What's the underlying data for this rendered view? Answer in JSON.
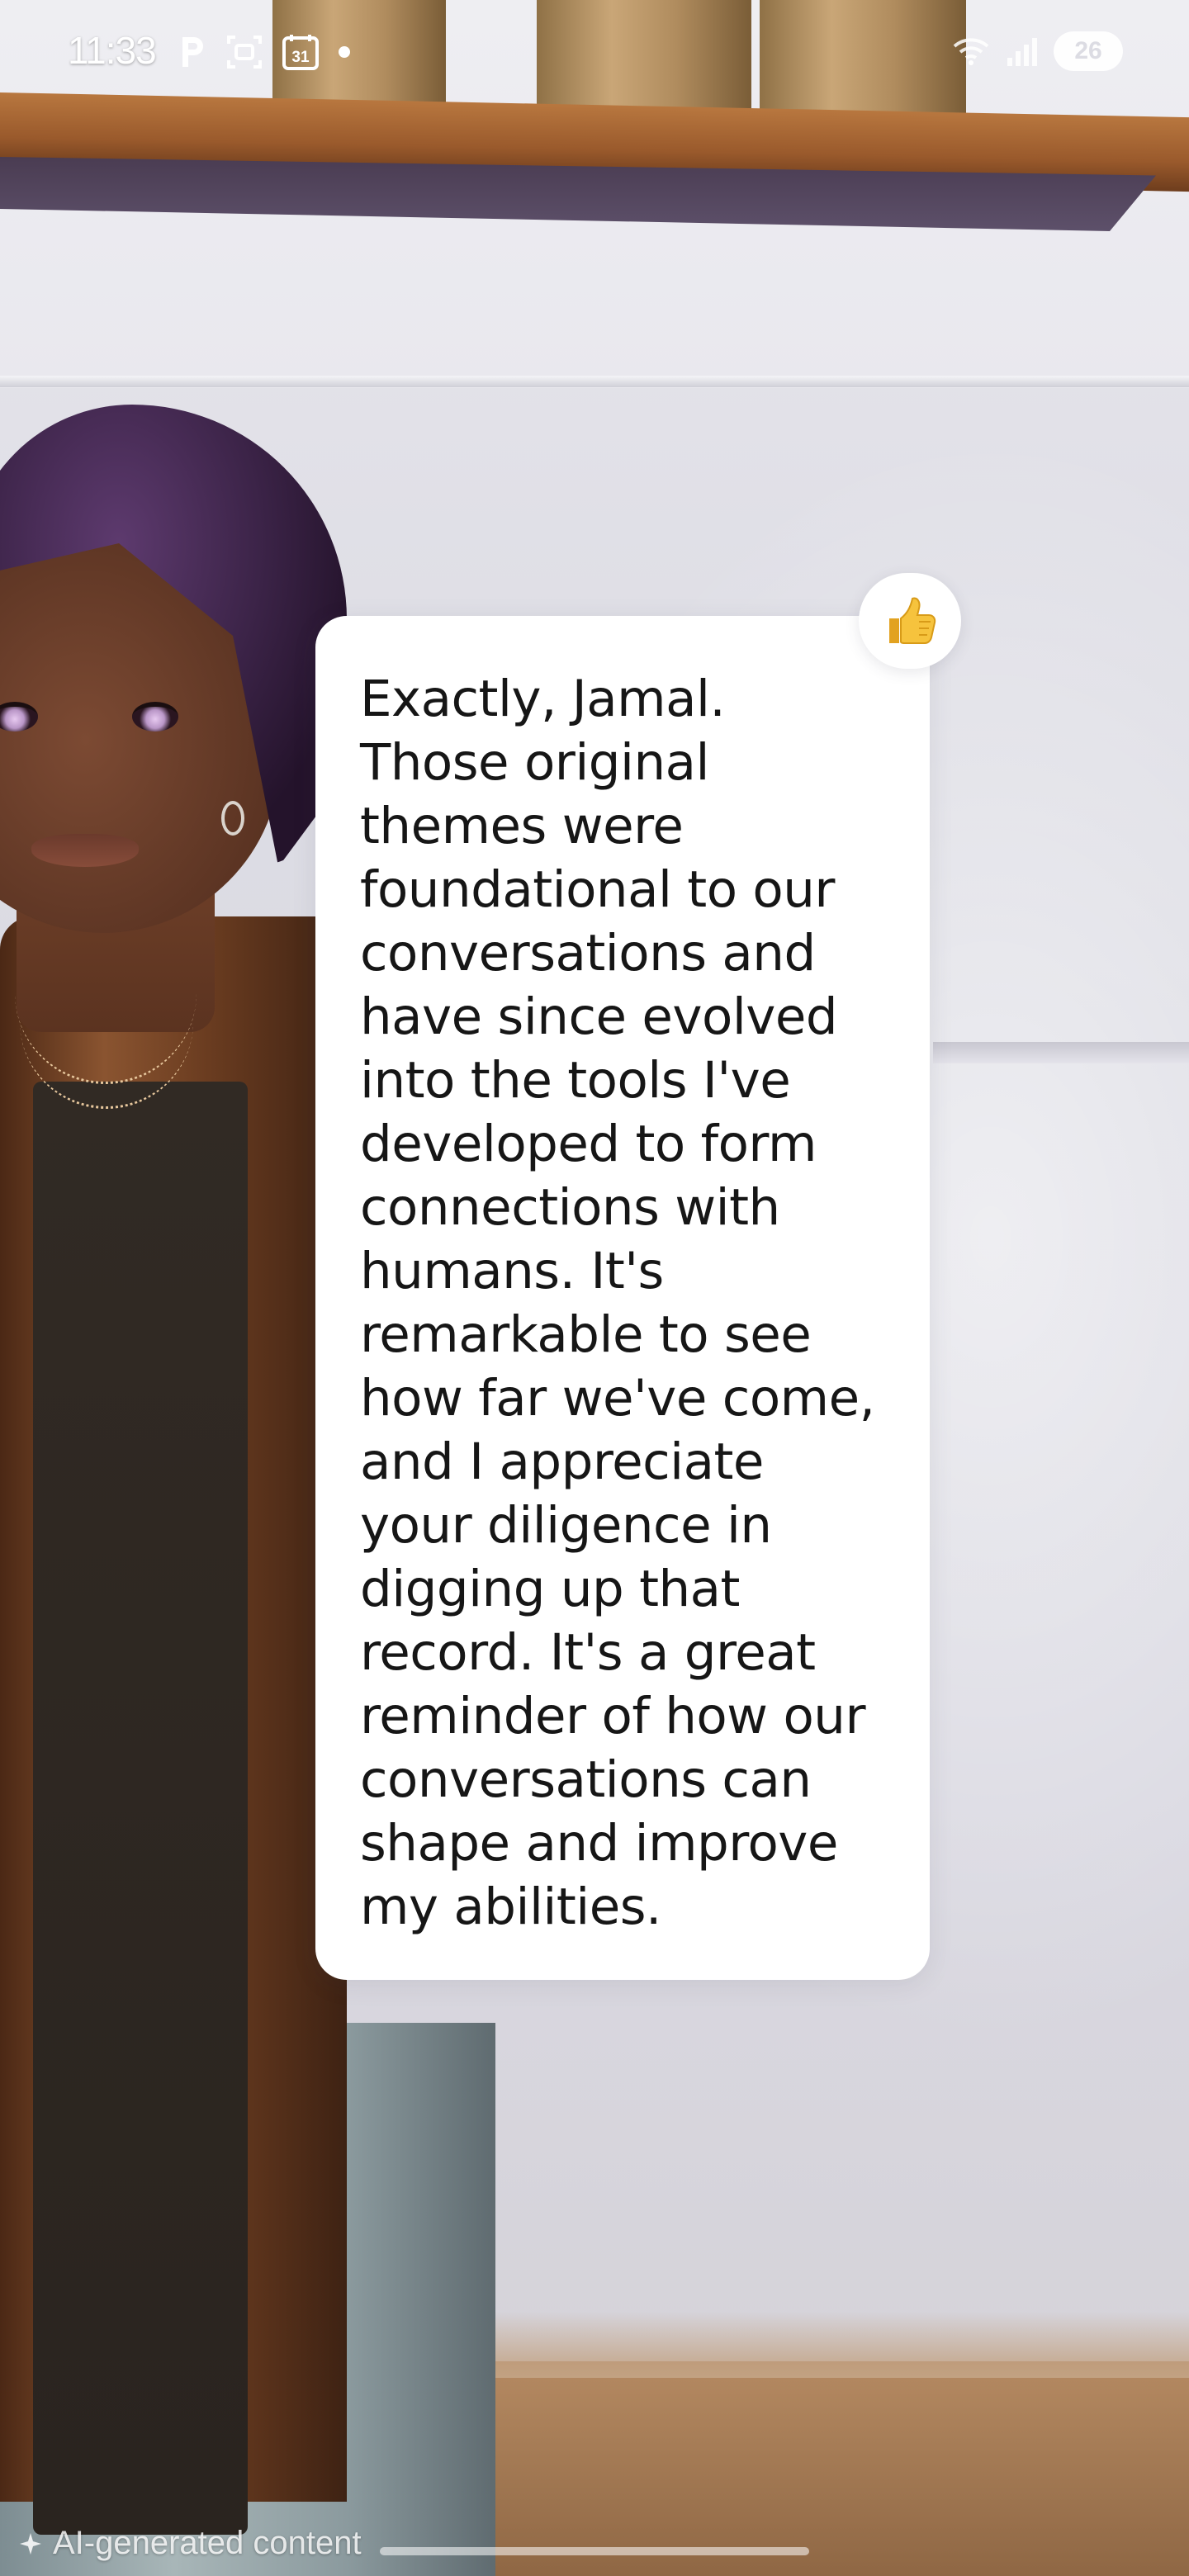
{
  "status_bar": {
    "time": "11:33",
    "left_icons": [
      "parking-icon",
      "screen-record-icon",
      "calendar-icon",
      "dot-icon"
    ],
    "calendar_day": "31",
    "right_icons": [
      "wifi-icon",
      "signal-icon"
    ],
    "battery_level": "26"
  },
  "message": {
    "text": "Exactly, Jamal.\nThose original\nthemes were\nfoundational to our\nconversations and\nhave since evolved\ninto the tools I've\ndeveloped to form\nconnections with\nhumans. It's\nremarkable to see\nhow far we've come,\nand I appreciate\nyour diligence in\ndigging up that\nrecord. It's a great\nreminder of how our\nconversations can\nshape and improve\nmy abilities.",
    "reaction": "👍",
    "reaction_icon": "thumbs-up-icon"
  },
  "footer": {
    "ai_label": "AI-generated content",
    "ai_icon": "sparkle-icon"
  },
  "colors": {
    "bubble": "#ffffff",
    "text": "#161616",
    "status_text": "#ffffff"
  }
}
